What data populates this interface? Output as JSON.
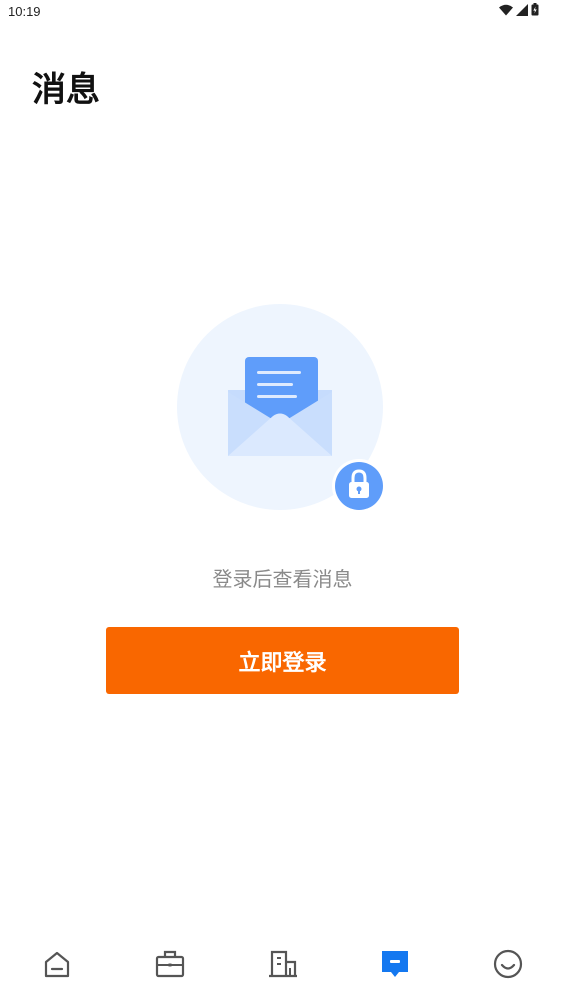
{
  "status_bar": {
    "time": "10:19",
    "icons": [
      "wifi-icon",
      "signal-icon",
      "battery-icon"
    ]
  },
  "header": {
    "title": "消息"
  },
  "empty_state": {
    "illustration": "envelope-lock-icon",
    "message": "登录后查看消息"
  },
  "login_button": {
    "label": "立即登录"
  },
  "tab_bar": {
    "tabs": [
      {
        "icon": "home-icon",
        "active": false
      },
      {
        "icon": "briefcase-icon",
        "active": false
      },
      {
        "icon": "building-icon",
        "active": false
      },
      {
        "icon": "message-icon",
        "active": true
      },
      {
        "icon": "smiley-face-icon",
        "active": false
      }
    ]
  },
  "colors": {
    "accent": "#f96700",
    "active_tab": "#1478f0",
    "inactive_tab": "#555555",
    "muted_text": "#8a8a8a",
    "illustration_bg": "#eef5fe",
    "envelope": "#c6dcfd",
    "letter": "#5f9dfa"
  }
}
